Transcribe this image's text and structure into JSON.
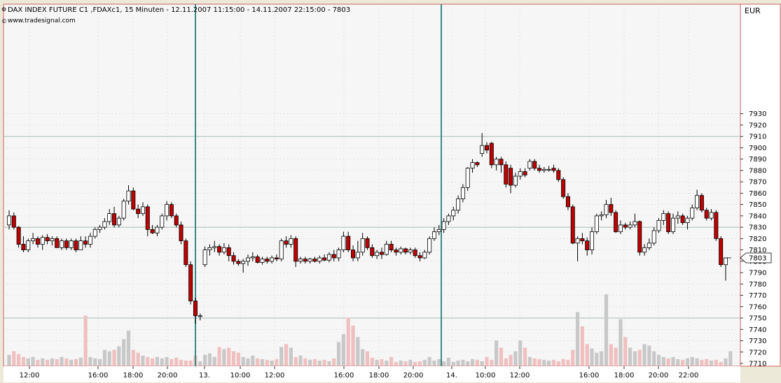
{
  "chart_data": {
    "type": "candlestick",
    "title": "DAX INDEX FUTURE C1 ,FDAXc1, 15 Minuten - 12.11.2007 11:15:00 - 14.11.2007 22:15:00 - 7803",
    "subtitle": "www.tradesignal.com",
    "currency_label": "EUR",
    "last_value_label": "7803",
    "y_range": [
      7710,
      7940
    ],
    "y_ticks": [
      7710,
      7720,
      7730,
      7740,
      7750,
      7760,
      7770,
      7780,
      7790,
      7800,
      7810,
      7820,
      7830,
      7840,
      7850,
      7860,
      7870,
      7880,
      7890,
      7900,
      7910,
      7920,
      7930
    ],
    "h_levels": [
      7910,
      7830,
      7750
    ],
    "x_ticks": [
      "12:00",
      "16:00",
      "18:00",
      "20:00",
      "13.",
      "10:00",
      "12:00",
      "16:00",
      "18:00",
      "20:00",
      "14.",
      "10:00",
      "12:00",
      "16:00",
      "18:00",
      "20:00",
      "22:00"
    ],
    "day_separator_labels": [
      "13.",
      "14."
    ],
    "candles": [
      {
        "o": 7832,
        "h": 7845,
        "l": 7828,
        "c": 7840
      },
      {
        "o": 7840,
        "h": 7843,
        "l": 7828,
        "c": 7830
      },
      {
        "o": 7830,
        "h": 7831,
        "l": 7812,
        "c": 7815
      },
      {
        "o": 7815,
        "h": 7822,
        "l": 7808,
        "c": 7810
      },
      {
        "o": 7810,
        "h": 7820,
        "l": 7808,
        "c": 7818
      },
      {
        "o": 7818,
        "h": 7825,
        "l": 7815,
        "c": 7820
      },
      {
        "o": 7820,
        "h": 7822,
        "l": 7812,
        "c": 7815
      },
      {
        "o": 7815,
        "h": 7823,
        "l": 7810,
        "c": 7821
      },
      {
        "o": 7821,
        "h": 7824,
        "l": 7815,
        "c": 7818
      },
      {
        "o": 7818,
        "h": 7822,
        "l": 7814,
        "c": 7820
      },
      {
        "o": 7820,
        "h": 7822,
        "l": 7812,
        "c": 7812
      },
      {
        "o": 7812,
        "h": 7820,
        "l": 7810,
        "c": 7818
      },
      {
        "o": 7818,
        "h": 7820,
        "l": 7810,
        "c": 7812
      },
      {
        "o": 7812,
        "h": 7820,
        "l": 7810,
        "c": 7818
      },
      {
        "o": 7818,
        "h": 7820,
        "l": 7808,
        "c": 7810
      },
      {
        "o": 7810,
        "h": 7822,
        "l": 7810,
        "c": 7818
      },
      {
        "o": 7818,
        "h": 7822,
        "l": 7812,
        "c": 7815
      },
      {
        "o": 7815,
        "h": 7825,
        "l": 7812,
        "c": 7822
      },
      {
        "o": 7822,
        "h": 7830,
        "l": 7820,
        "c": 7828
      },
      {
        "o": 7828,
        "h": 7832,
        "l": 7825,
        "c": 7830
      },
      {
        "o": 7830,
        "h": 7838,
        "l": 7828,
        "c": 7835
      },
      {
        "o": 7835,
        "h": 7846,
        "l": 7832,
        "c": 7842
      },
      {
        "o": 7842,
        "h": 7848,
        "l": 7830,
        "c": 7832
      },
      {
        "o": 7832,
        "h": 7840,
        "l": 7830,
        "c": 7838
      },
      {
        "o": 7838,
        "h": 7855,
        "l": 7836,
        "c": 7853
      },
      {
        "o": 7853,
        "h": 7867,
        "l": 7850,
        "c": 7862
      },
      {
        "o": 7862,
        "h": 7865,
        "l": 7845,
        "c": 7846
      },
      {
        "o": 7846,
        "h": 7850,
        "l": 7838,
        "c": 7842
      },
      {
        "o": 7842,
        "h": 7852,
        "l": 7840,
        "c": 7848
      },
      {
        "o": 7848,
        "h": 7850,
        "l": 7822,
        "c": 7828
      },
      {
        "o": 7828,
        "h": 7832,
        "l": 7824,
        "c": 7825
      },
      {
        "o": 7825,
        "h": 7832,
        "l": 7822,
        "c": 7830
      },
      {
        "o": 7830,
        "h": 7842,
        "l": 7828,
        "c": 7840
      },
      {
        "o": 7840,
        "h": 7853,
        "l": 7836,
        "c": 7850
      },
      {
        "o": 7850,
        "h": 7852,
        "l": 7838,
        "c": 7840
      },
      {
        "o": 7840,
        "h": 7842,
        "l": 7830,
        "c": 7832
      },
      {
        "o": 7832,
        "h": 7835,
        "l": 7815,
        "c": 7818
      },
      {
        "o": 7818,
        "h": 7820,
        "l": 7795,
        "c": 7797
      },
      {
        "o": 7797,
        "h": 7800,
        "l": 7762,
        "c": 7765
      },
      {
        "o": 7765,
        "h": 7768,
        "l": 7745,
        "c": 7752
      },
      {
        "o": 7752,
        "h": 7754,
        "l": 7748,
        "c": 7752
      },
      {
        "o": 7797,
        "h": 7813,
        "l": 7795,
        "c": 7810
      },
      {
        "o": 7810,
        "h": 7815,
        "l": 7805,
        "c": 7812
      },
      {
        "o": 7812,
        "h": 7818,
        "l": 7808,
        "c": 7813
      },
      {
        "o": 7813,
        "h": 7815,
        "l": 7805,
        "c": 7808
      },
      {
        "o": 7808,
        "h": 7816,
        "l": 7806,
        "c": 7812
      },
      {
        "o": 7812,
        "h": 7815,
        "l": 7800,
        "c": 7805
      },
      {
        "o": 7805,
        "h": 7808,
        "l": 7797,
        "c": 7800
      },
      {
        "o": 7800,
        "h": 7802,
        "l": 7796,
        "c": 7798
      },
      {
        "o": 7798,
        "h": 7802,
        "l": 7790,
        "c": 7800
      },
      {
        "o": 7800,
        "h": 7806,
        "l": 7796,
        "c": 7803
      },
      {
        "o": 7803,
        "h": 7808,
        "l": 7800,
        "c": 7804
      },
      {
        "o": 7804,
        "h": 7806,
        "l": 7798,
        "c": 7799
      },
      {
        "o": 7799,
        "h": 7804,
        "l": 7797,
        "c": 7802
      },
      {
        "o": 7802,
        "h": 7804,
        "l": 7798,
        "c": 7800
      },
      {
        "o": 7800,
        "h": 7805,
        "l": 7798,
        "c": 7803
      },
      {
        "o": 7803,
        "h": 7806,
        "l": 7800,
        "c": 7802
      },
      {
        "o": 7802,
        "h": 7820,
        "l": 7800,
        "c": 7818
      },
      {
        "o": 7818,
        "h": 7822,
        "l": 7812,
        "c": 7815
      },
      {
        "o": 7815,
        "h": 7823,
        "l": 7812,
        "c": 7820
      },
      {
        "o": 7820,
        "h": 7822,
        "l": 7795,
        "c": 7800
      },
      {
        "o": 7800,
        "h": 7804,
        "l": 7798,
        "c": 7802
      },
      {
        "o": 7802,
        "h": 7804,
        "l": 7798,
        "c": 7800
      },
      {
        "o": 7800,
        "h": 7803,
        "l": 7798,
        "c": 7802
      },
      {
        "o": 7802,
        "h": 7804,
        "l": 7799,
        "c": 7800
      },
      {
        "o": 7800,
        "h": 7805,
        "l": 7798,
        "c": 7803
      },
      {
        "o": 7803,
        "h": 7806,
        "l": 7800,
        "c": 7801
      },
      {
        "o": 7801,
        "h": 7808,
        "l": 7799,
        "c": 7806
      },
      {
        "o": 7806,
        "h": 7810,
        "l": 7800,
        "c": 7803
      },
      {
        "o": 7803,
        "h": 7812,
        "l": 7800,
        "c": 7810
      },
      {
        "o": 7810,
        "h": 7826,
        "l": 7808,
        "c": 7822
      },
      {
        "o": 7822,
        "h": 7826,
        "l": 7808,
        "c": 7810
      },
      {
        "o": 7810,
        "h": 7814,
        "l": 7800,
        "c": 7803
      },
      {
        "o": 7803,
        "h": 7818,
        "l": 7800,
        "c": 7808
      },
      {
        "o": 7808,
        "h": 7825,
        "l": 7805,
        "c": 7820
      },
      {
        "o": 7820,
        "h": 7822,
        "l": 7810,
        "c": 7812
      },
      {
        "o": 7812,
        "h": 7815,
        "l": 7803,
        "c": 7805
      },
      {
        "o": 7805,
        "h": 7810,
        "l": 7802,
        "c": 7808
      },
      {
        "o": 7808,
        "h": 7812,
        "l": 7802,
        "c": 7806
      },
      {
        "o": 7806,
        "h": 7818,
        "l": 7805,
        "c": 7815
      },
      {
        "o": 7815,
        "h": 7818,
        "l": 7808,
        "c": 7810
      },
      {
        "o": 7810,
        "h": 7812,
        "l": 7805,
        "c": 7808
      },
      {
        "o": 7808,
        "h": 7813,
        "l": 7806,
        "c": 7811
      },
      {
        "o": 7811,
        "h": 7812,
        "l": 7806,
        "c": 7808
      },
      {
        "o": 7808,
        "h": 7812,
        "l": 7806,
        "c": 7810
      },
      {
        "o": 7810,
        "h": 7812,
        "l": 7803,
        "c": 7805
      },
      {
        "o": 7805,
        "h": 7808,
        "l": 7800,
        "c": 7803
      },
      {
        "o": 7803,
        "h": 7810,
        "l": 7802,
        "c": 7808
      },
      {
        "o": 7808,
        "h": 7822,
        "l": 7806,
        "c": 7820
      },
      {
        "o": 7820,
        "h": 7830,
        "l": 7818,
        "c": 7826
      },
      {
        "o": 7826,
        "h": 7832,
        "l": 7823,
        "c": 7828
      },
      {
        "o": 7828,
        "h": 7838,
        "l": 7825,
        "c": 7835
      },
      {
        "o": 7835,
        "h": 7842,
        "l": 7832,
        "c": 7840
      },
      {
        "o": 7840,
        "h": 7848,
        "l": 7836,
        "c": 7845
      },
      {
        "o": 7845,
        "h": 7858,
        "l": 7842,
        "c": 7855
      },
      {
        "o": 7855,
        "h": 7868,
        "l": 7852,
        "c": 7865
      },
      {
        "o": 7865,
        "h": 7883,
        "l": 7862,
        "c": 7882
      },
      {
        "o": 7882,
        "h": 7890,
        "l": 7878,
        "c": 7887
      },
      {
        "o": 7887,
        "h": 7888,
        "l": 7883,
        "c": 7885
      },
      {
        "o": 7895,
        "h": 7913,
        "l": 7892,
        "c": 7902
      },
      {
        "o": 7902,
        "h": 7905,
        "l": 7895,
        "c": 7898
      },
      {
        "o": 7904,
        "h": 7905,
        "l": 7882,
        "c": 7885
      },
      {
        "o": 7885,
        "h": 7892,
        "l": 7880,
        "c": 7890
      },
      {
        "o": 7890,
        "h": 7892,
        "l": 7878,
        "c": 7885
      },
      {
        "o": 7885,
        "h": 7888,
        "l": 7865,
        "c": 7868
      },
      {
        "o": 7882,
        "h": 7885,
        "l": 7860,
        "c": 7867
      },
      {
        "o": 7867,
        "h": 7878,
        "l": 7865,
        "c": 7875
      },
      {
        "o": 7875,
        "h": 7882,
        "l": 7872,
        "c": 7879
      },
      {
        "o": 7879,
        "h": 7882,
        "l": 7874,
        "c": 7876
      },
      {
        "o": 7882,
        "h": 7890,
        "l": 7880,
        "c": 7888
      },
      {
        "o": 7888,
        "h": 7890,
        "l": 7880,
        "c": 7882
      },
      {
        "o": 7882,
        "h": 7885,
        "l": 7878,
        "c": 7880
      },
      {
        "o": 7880,
        "h": 7883,
        "l": 7878,
        "c": 7881
      },
      {
        "o": 7881,
        "h": 7884,
        "l": 7879,
        "c": 7881
      },
      {
        "o": 7882,
        "h": 7885,
        "l": 7878,
        "c": 7880
      },
      {
        "o": 7880,
        "h": 7882,
        "l": 7870,
        "c": 7872
      },
      {
        "o": 7872,
        "h": 7874,
        "l": 7855,
        "c": 7857
      },
      {
        "o": 7857,
        "h": 7860,
        "l": 7845,
        "c": 7848
      },
      {
        "o": 7848,
        "h": 7850,
        "l": 7815,
        "c": 7816
      },
      {
        "o": 7816,
        "h": 7822,
        "l": 7800,
        "c": 7820
      },
      {
        "o": 7820,
        "h": 7825,
        "l": 7815,
        "c": 7818
      },
      {
        "o": 7818,
        "h": 7821,
        "l": 7805,
        "c": 7810
      },
      {
        "o": 7810,
        "h": 7830,
        "l": 7806,
        "c": 7826
      },
      {
        "o": 7826,
        "h": 7842,
        "l": 7824,
        "c": 7840
      },
      {
        "o": 7840,
        "h": 7844,
        "l": 7836,
        "c": 7841
      },
      {
        "o": 7841,
        "h": 7854,
        "l": 7838,
        "c": 7850
      },
      {
        "o": 7850,
        "h": 7856,
        "l": 7840,
        "c": 7843
      },
      {
        "o": 7843,
        "h": 7845,
        "l": 7825,
        "c": 7826
      },
      {
        "o": 7826,
        "h": 7836,
        "l": 7824,
        "c": 7832
      },
      {
        "o": 7832,
        "h": 7834,
        "l": 7828,
        "c": 7830
      },
      {
        "o": 7830,
        "h": 7835,
        "l": 7828,
        "c": 7832
      },
      {
        "o": 7832,
        "h": 7842,
        "l": 7830,
        "c": 7835
      },
      {
        "o": 7835,
        "h": 7836,
        "l": 7805,
        "c": 7808
      },
      {
        "o": 7808,
        "h": 7815,
        "l": 7805,
        "c": 7812
      },
      {
        "o": 7812,
        "h": 7820,
        "l": 7810,
        "c": 7816
      },
      {
        "o": 7816,
        "h": 7830,
        "l": 7814,
        "c": 7827
      },
      {
        "o": 7827,
        "h": 7838,
        "l": 7825,
        "c": 7836
      },
      {
        "o": 7836,
        "h": 7845,
        "l": 7832,
        "c": 7842
      },
      {
        "o": 7842,
        "h": 7844,
        "l": 7824,
        "c": 7826
      },
      {
        "o": 7826,
        "h": 7842,
        "l": 7824,
        "c": 7838
      },
      {
        "o": 7838,
        "h": 7844,
        "l": 7833,
        "c": 7840
      },
      {
        "o": 7840,
        "h": 7842,
        "l": 7832,
        "c": 7834
      },
      {
        "o": 7834,
        "h": 7840,
        "l": 7828,
        "c": 7838
      },
      {
        "o": 7838,
        "h": 7850,
        "l": 7836,
        "c": 7847
      },
      {
        "o": 7847,
        "h": 7863,
        "l": 7845,
        "c": 7858
      },
      {
        "o": 7858,
        "h": 7860,
        "l": 7843,
        "c": 7845
      },
      {
        "o": 7845,
        "h": 7847,
        "l": 7836,
        "c": 7838
      },
      {
        "o": 7838,
        "h": 7846,
        "l": 7836,
        "c": 7843
      },
      {
        "o": 7843,
        "h": 7845,
        "l": 7818,
        "c": 7820
      },
      {
        "o": 7820,
        "h": 7822,
        "l": 7795,
        "c": 7797
      },
      {
        "o": 7797,
        "h": 7800,
        "l": 7783,
        "c": 7803
      }
    ],
    "volume": [
      0.15,
      0.2,
      0.16,
      0.12,
      0.1,
      0.12,
      0.08,
      0.1,
      0.08,
      0.1,
      0.09,
      0.12,
      0.1,
      0.08,
      0.09,
      0.11,
      0.7,
      0.12,
      0.1,
      0.09,
      0.22,
      0.2,
      0.22,
      0.27,
      0.37,
      0.49,
      0.22,
      0.18,
      0.14,
      0.12,
      0.1,
      0.12,
      0.1,
      0.12,
      0.09,
      0.11,
      0.08,
      0.07,
      0.07,
      0.14,
      0.06,
      0.15,
      0.17,
      0.12,
      0.26,
      0.23,
      0.25,
      0.2,
      0.18,
      0.12,
      0.1,
      0.14,
      0.1,
      0.09,
      0.08,
      0.07,
      0.09,
      0.26,
      0.3,
      0.25,
      0.12,
      0.14,
      0.1,
      0.08,
      0.09,
      0.07,
      0.08,
      0.06,
      0.1,
      0.33,
      0.44,
      0.67,
      0.56,
      0.4,
      0.23,
      0.2,
      0.11,
      0.08,
      0.09,
      0.07,
      0.12,
      0.05,
      0.07,
      0.06,
      0.08,
      0.05,
      0.06,
      0.08,
      0.12,
      0.07,
      0.09,
      0.06,
      0.11,
      0.05,
      0.07,
      0.08,
      0.06,
      0.09,
      0.08,
      0.06,
      0.12,
      0.08,
      0.35,
      0.25,
      0.1,
      0.15,
      0.2,
      0.35,
      0.25,
      0.12,
      0.1,
      0.09,
      0.08,
      0.07,
      0.08,
      0.06,
      0.09,
      0.08,
      0.22,
      0.75,
      0.55,
      0.3,
      0.24,
      0.18,
      0.2,
      1.0,
      0.3,
      0.25,
      0.65,
      0.4,
      0.25,
      0.2,
      0.22,
      0.3,
      0.28,
      0.2,
      0.15,
      0.12,
      0.1,
      0.12,
      0.09,
      0.08,
      0.1,
      0.12,
      0.1,
      0.08,
      0.09,
      0.07,
      0.08,
      0.05,
      0.1,
      0.2
    ]
  }
}
